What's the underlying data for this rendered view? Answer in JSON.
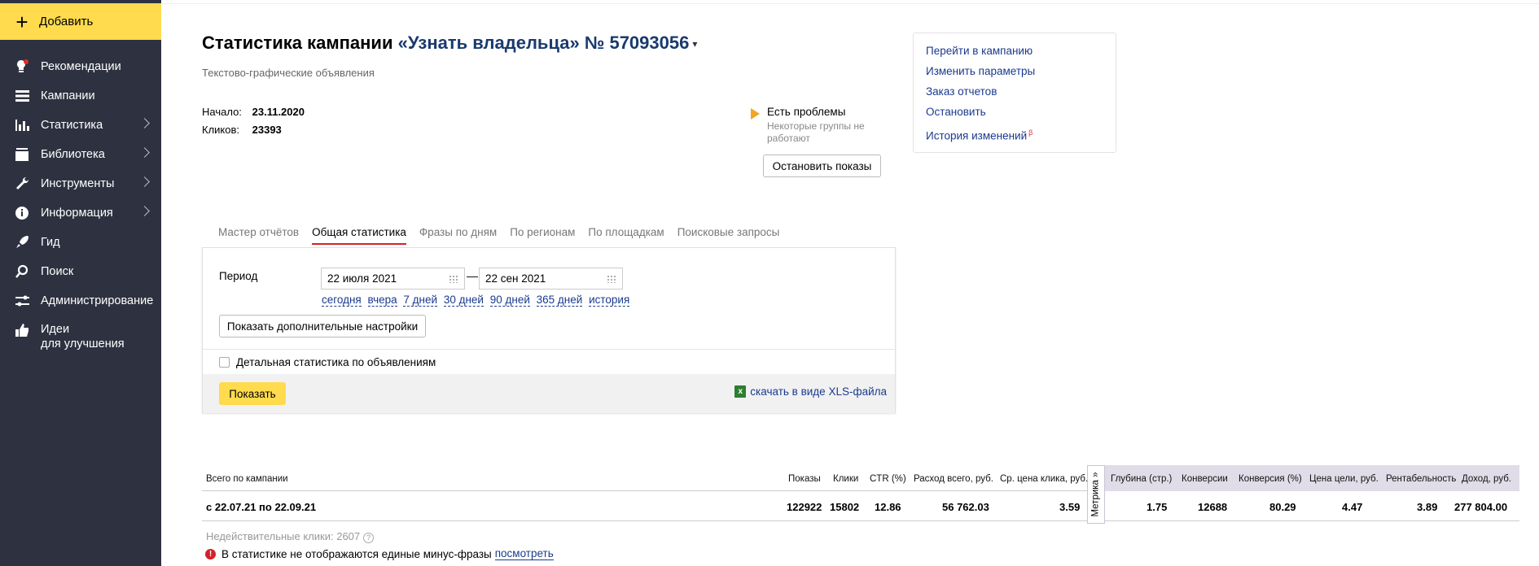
{
  "sidebar": {
    "add_label": "Добавить",
    "items": [
      {
        "label": "Рекомендации",
        "icon": "lightbulb-icon",
        "chevron": false
      },
      {
        "label": "Кампании",
        "icon": "list-icon",
        "chevron": false
      },
      {
        "label": "Статистика",
        "icon": "bar-chart-icon",
        "chevron": true
      },
      {
        "label": "Библиотека",
        "icon": "library-icon",
        "chevron": true
      },
      {
        "label": "Инструменты",
        "icon": "wrench-icon",
        "chevron": true
      },
      {
        "label": "Информация",
        "icon": "info-icon",
        "chevron": true
      },
      {
        "label": "Гид",
        "icon": "rocket-icon",
        "chevron": false
      },
      {
        "label": "Поиск",
        "icon": "search-icon",
        "chevron": false
      },
      {
        "label": "Администрирование",
        "icon": "sliders-icon",
        "chevron": false
      },
      {
        "label": "Идеи",
        "label2": "для улучшения",
        "icon": "thumbs-up-icon",
        "chevron": false
      }
    ]
  },
  "header": {
    "title_prefix": "Статистика кампании",
    "campaign_name": "«Узнать владельца» № 57093056",
    "caret": "▾",
    "subtitle": "Текстово-графические объявления",
    "start_label": "Начало:",
    "start_value": "23.11.2020",
    "clicks_label": "Кликов:",
    "clicks_value": "23393"
  },
  "problems": {
    "title": "Есть проблемы",
    "text": "Некоторые группы не работают",
    "stop_button": "Остановить показы"
  },
  "links": [
    "Перейти в кампанию",
    "Изменить параметры",
    "Заказ отчетов",
    "Остановить",
    "История изменений"
  ],
  "links_beta": "β",
  "tabs": [
    "Мастер отчётов",
    "Общая статистика",
    "Фразы по дням",
    "По регионам",
    "По площадкам",
    "Поисковые запросы"
  ],
  "form": {
    "period_label": "Период",
    "date_from": "22 июля 2021",
    "date_to": "22 сен 2021",
    "dash": "—",
    "quick": [
      "сегодня",
      "вчера",
      "7 дней",
      "30 дней",
      "90 дней",
      "365 дней",
      "история"
    ],
    "more_settings": "Показать дополнительные настройки",
    "detail_checkbox": "Детальная статистика по объявлениям",
    "show_button": "Показать",
    "xls_link": "скачать в виде XLS-файла"
  },
  "stats": {
    "headers": {
      "total": "Всего по кампании",
      "shows": "Показы",
      "clicks": "Клики",
      "ctr": "CTR (%)",
      "spend": "Расход всего, руб.",
      "avg_cpc": "Ср. цена клика, руб.",
      "depth": "Глубина (стр.)",
      "conversions": "Конверсии",
      "conv_rate": "Конверсия (%)",
      "goal_cost": "Цена цели, руб.",
      "profitability": "Рентабельность",
      "income": "Доход, руб."
    },
    "metrika_label": "Метрика »",
    "row": {
      "period": "с 22.07.21 по 22.09.21",
      "shows": "122922",
      "clicks": "15802",
      "ctr": "12.86",
      "spend": "56 762.03",
      "avg_cpc": "3.59",
      "depth": "1.75",
      "conversions": "12688",
      "conv_rate": "80.29",
      "goal_cost": "4.47",
      "profitability": "3.89",
      "income": "277 804.00"
    },
    "invalid_clicks": "Недействительные клики: 2607",
    "warning_text": "В статистике не отображаются единые минус-фразы",
    "warning_link": "посмотреть"
  }
}
